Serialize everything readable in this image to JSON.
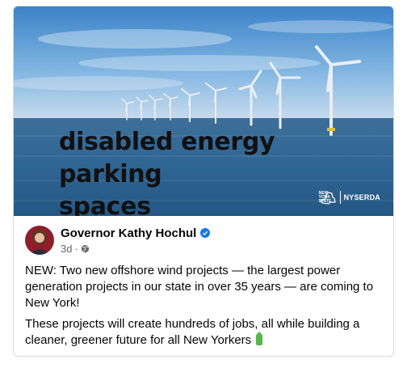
{
  "post_image": {
    "overlay_line1": "disabled energy parking",
    "overlay_line2": "spaces",
    "logo_state_text": "NEW YORK STATE",
    "logo_org": "NYSERDA"
  },
  "post": {
    "author": "Governor Kathy Hochul",
    "verified": true,
    "timestamp": "3d",
    "separator": "·",
    "privacy_icon": "globe-icon",
    "paragraph1": "NEW: Two new offshore wind projects — the largest power generation projects in our state in over 35 years — are coming to New York!",
    "paragraph2": "These projects will create hundreds of jobs, all while building a cleaner, greener future for all New Yorkers",
    "paragraph2_emoji": "battery-icon"
  },
  "colors": {
    "verified_badge": "#1877f2",
    "text": "#050505",
    "secondary_text": "#65676b",
    "battery": "#57b84a"
  }
}
